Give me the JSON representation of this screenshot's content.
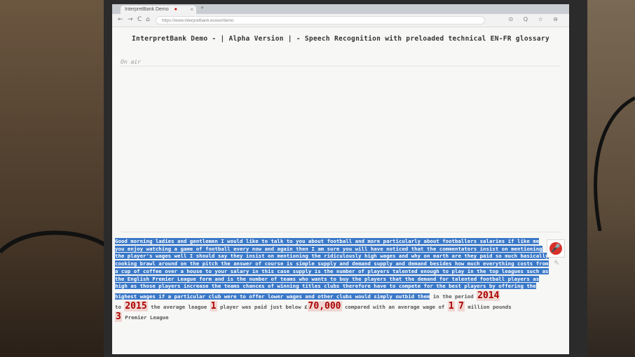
{
  "browser": {
    "tab_title": "InterpretBank Demo",
    "tab_close": "×",
    "new_tab": "+",
    "url": "https://www.interpretbank.eu/asr/demo",
    "nav_back": "←",
    "nav_forward": "→",
    "nav_reload": "C",
    "nav_home": "⌂",
    "right_icons": "⊙ Q ☆ ⊖"
  },
  "page": {
    "title": "InterpretBank Demo - | Alpha Version | - Speech Recognition with preloaded technical EN-FR glossary",
    "status": "On air"
  },
  "transcript": {
    "highlighted": "Good morning ladies and gentlemen I would like to talk to you about football and more particularly about footballers salaries if like me you enjoy watching a game of football every now and again then I am sure you will have noticed that the commentators insist on mentioning the player's wages well I should say they insist on mentioning the ridiculously high wages and why on earth are they paid so much basically cooking brawl around on the pitch the answer of course is simple supply and demand supply and demand besides how much everything costs from a cup of coffee over a house to your salary in this case supply is the number of players talented enough to play in the top leagues such as the English Premier League form and is the number of teams who wants to buy the players that the demand for talented football players as high as those players increase the teams chances of winning titles clubs therefore have to compete for the best players by offering the highest wages if a particular club were to offer lower wages and other clubs would simply outbid them",
    "t1": " in the period ",
    "n1": "2014",
    "t2": "to ",
    "n2": "2015",
    "t3": " the average league ",
    "n3": "1",
    "t4": " player was paid just below £",
    "n4": "70,000",
    "t5": " compared with an average wage of ",
    "n5": "1",
    "t6": " ",
    "n6": "7",
    "t7": " million pounds",
    "n7": "3",
    "t8": " Premier League"
  },
  "controls": {
    "mic_icon": "microphone-icon",
    "mic_glyph": "🎤"
  },
  "colors": {
    "highlight": "#3a78c8",
    "number_text": "#a00000",
    "number_bg": "#f0d6d2",
    "mic": "#d9302a"
  }
}
